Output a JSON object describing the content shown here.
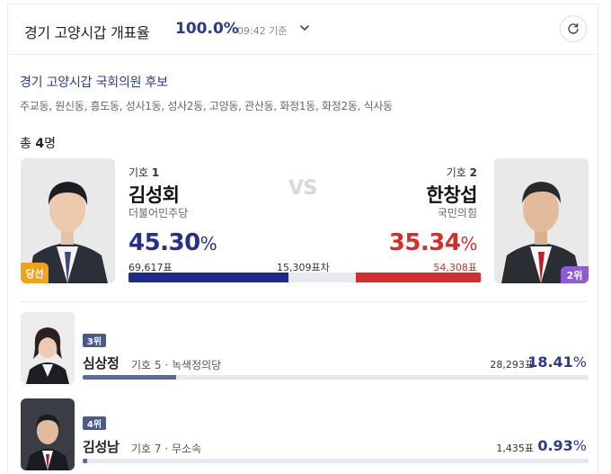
{
  "header": {
    "title": "경기 고양시갑 개표율",
    "count_percent": "100.0",
    "count_unit": "%",
    "time": "09:42 기준"
  },
  "section": {
    "title": "경기 고양시갑 국회의원 후보",
    "areas": "주교동, 원신동, 흥도동, 성사1동, 성사2동, 고양동, 관산동, 화정1동, 화정2동, 식사동",
    "total_prefix": "총 ",
    "total_count": "4",
    "total_suffix": "명"
  },
  "candidate1": {
    "number_label": "기호",
    "number": "1",
    "name": "김성회",
    "party": "더불어민주당",
    "percent": "45.30",
    "votes": "69,617표",
    "badge": "당선",
    "share": 45.3,
    "color": "#1d2b8a"
  },
  "vs": {
    "label": "VS",
    "difference": "15,309표차"
  },
  "candidate2": {
    "number_label": "기호",
    "number": "2",
    "name": "한창섭",
    "party": "국민의힘",
    "percent": "35.34",
    "votes": "54,308표",
    "badge": "2위",
    "share": 35.34,
    "color": "#d42d2d"
  },
  "others": [
    {
      "rank": "3위",
      "name": "심상정",
      "number_text": "기호 5",
      "party": "녹색정의당",
      "votes": "28,293표",
      "percent": "18.41",
      "share": 18.41
    },
    {
      "rank": "4위",
      "name": "김성남",
      "number_text": "기호 7",
      "party": "무소속",
      "votes": "1,435표",
      "percent": "0.93",
      "share": 0.93
    }
  ],
  "pct_sign": "%",
  "icons": {
    "chevron": "chevron-down-icon",
    "refresh": "refresh-icon"
  }
}
